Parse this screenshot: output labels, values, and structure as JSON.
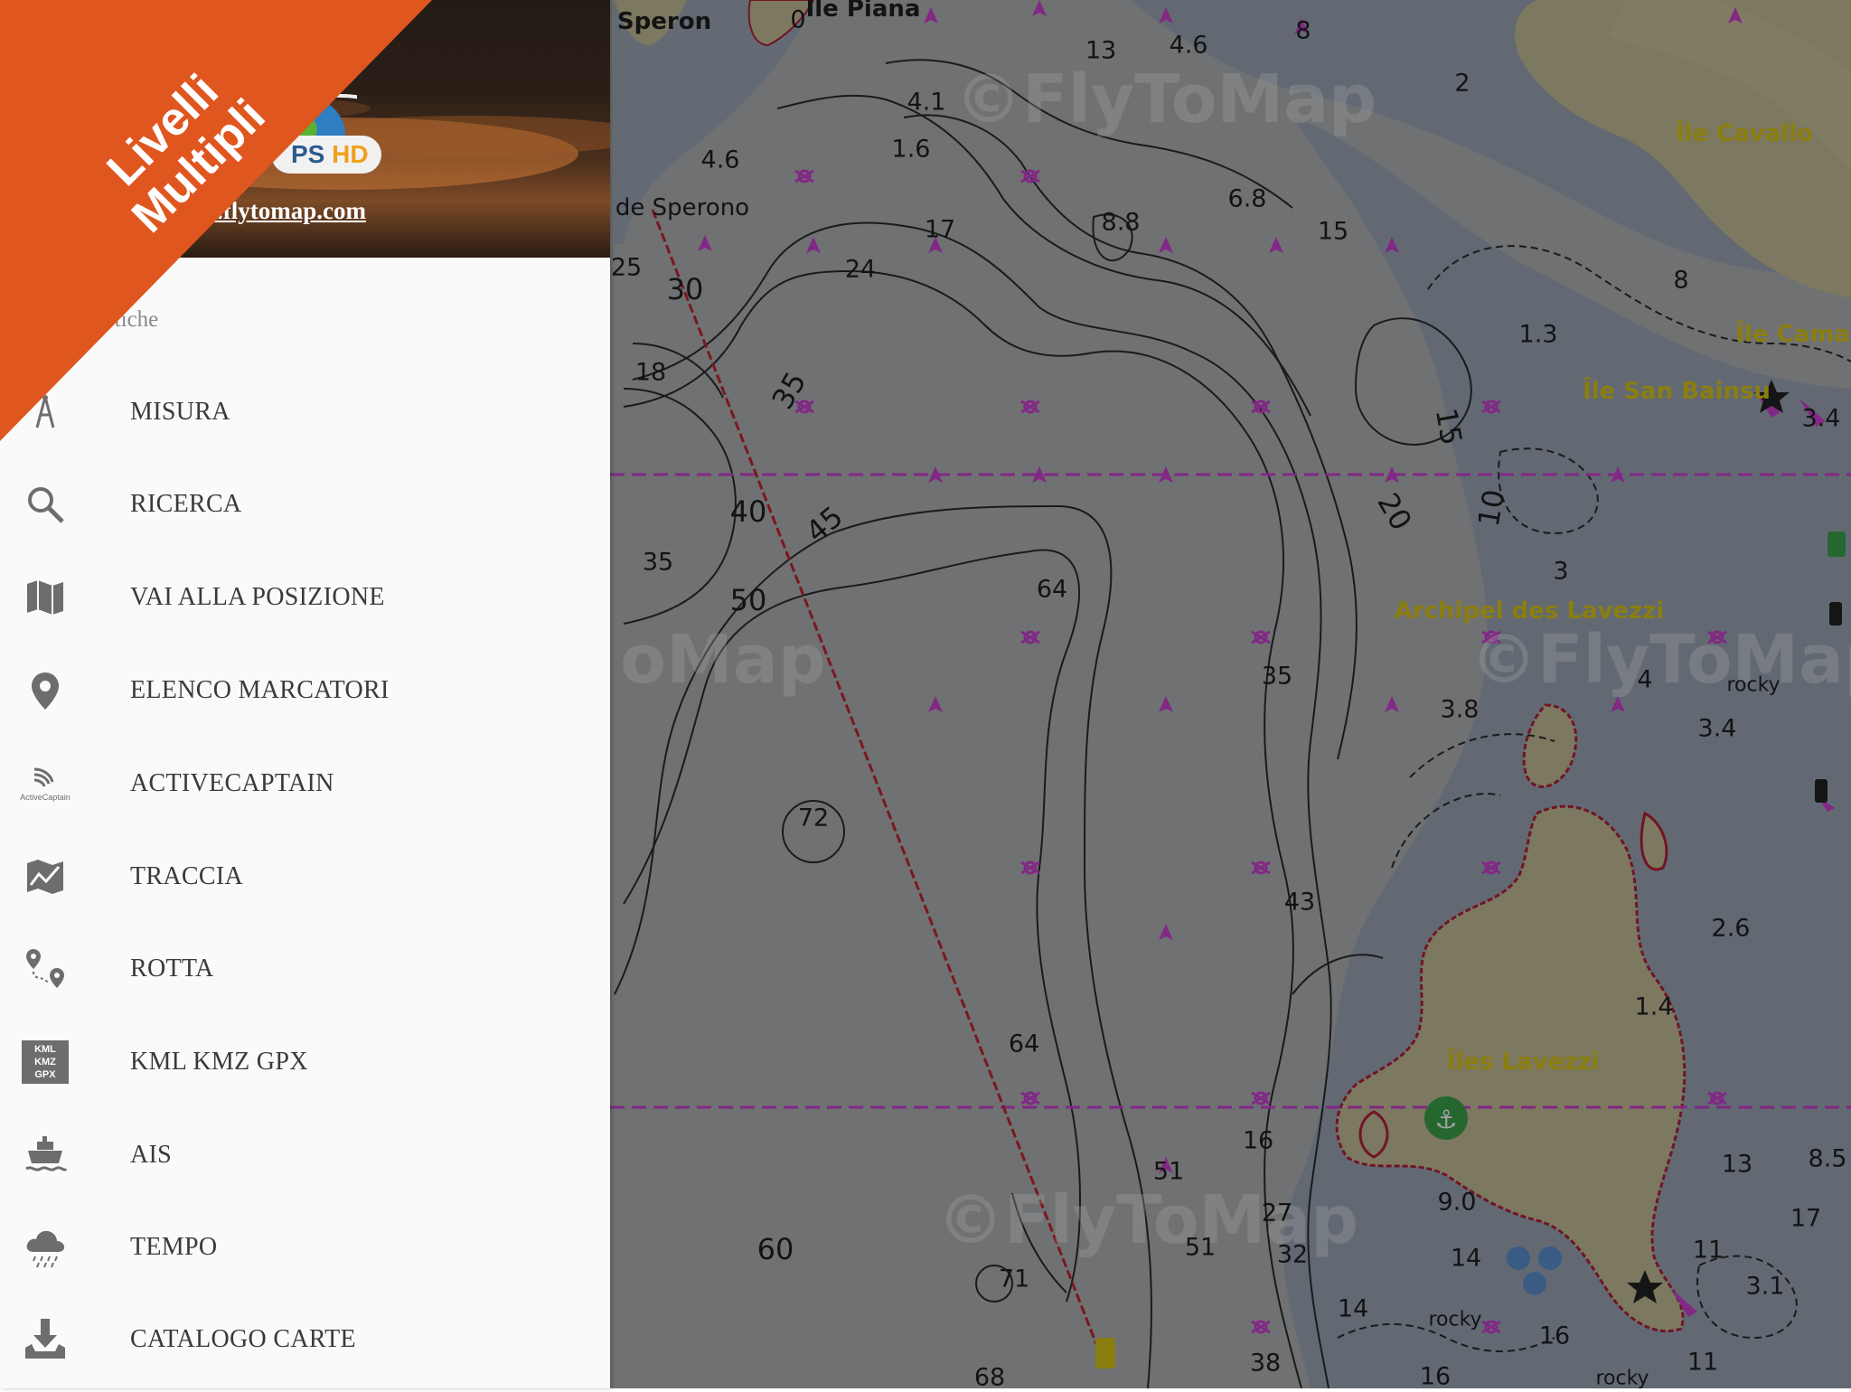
{
  "ribbon": {
    "line1": "Livelli",
    "line2": "Multipli",
    "color": "#e0561f"
  },
  "drawer": {
    "header": {
      "badge_partial": "PS",
      "badge_hd": "HD",
      "site_link": "ver.flytomap.com"
    },
    "section_label": "istiche",
    "items": [
      {
        "label": "MISURA",
        "icon": "compass-icon"
      },
      {
        "label": "RICERCA",
        "icon": "search-icon"
      },
      {
        "label": "VAI ALLA POSIZIONE",
        "icon": "map-icon"
      },
      {
        "label": "ELENCO MARCATORI",
        "icon": "location-pin-icon"
      },
      {
        "label": "ACTIVECAPTAIN",
        "icon": "activecaptain-icon",
        "icon_caption": "ActiveCaptain"
      },
      {
        "label": "TRACCIA",
        "icon": "track-map-icon"
      },
      {
        "label": "ROTTA",
        "icon": "route-icon"
      },
      {
        "label": "KML KMZ GPX",
        "icon": "kml-file-icon",
        "icon_lines": [
          "KML",
          "KMZ",
          "GPX"
        ]
      },
      {
        "label": "AIS",
        "icon": "ship-icon"
      },
      {
        "label": "TEMPO",
        "icon": "weather-cloud-icon"
      },
      {
        "label": "CATALOGO CARTE",
        "icon": "download-icon"
      }
    ]
  },
  "map": {
    "colors": {
      "sea": "#9aa5b5",
      "deep_sea": "#adb0b3",
      "land": "#c4bc96",
      "boundary": "#cc3fd1",
      "route": "#c1272d"
    },
    "watermarks": [
      "©FlyToMap",
      "©FlyToMap",
      "©FlyToMap",
      "oMap"
    ],
    "place_names": [
      "Speron",
      "Île Piana",
      "de Sperono",
      "Île Cavallo",
      "Île Camar",
      "Île San Bainsu",
      "Archipel des Lavezzi",
      "Îles Lavezzi",
      "rocky",
      "rocky",
      "rocky"
    ],
    "depths": [
      "0",
      "13",
      "4.6",
      "8",
      "2",
      "4.1",
      "1.6",
      "4.6",
      "6.8",
      "8.8",
      "15",
      "17",
      "24",
      "25",
      "30",
      "18",
      "35",
      "1.3",
      "8",
      "15",
      "3.4",
      "40",
      "45",
      "20",
      "10",
      "35",
      "50",
      "64",
      "3",
      "35",
      "4",
      "3.8",
      "3.4",
      "72",
      "43",
      "2.6",
      "1.4",
      "64",
      "16",
      "51",
      "13",
      "8.5",
      "27",
      "9.0",
      "17",
      "60",
      "71",
      "51",
      "32",
      "14",
      "11",
      "3.1",
      "14",
      "16",
      "11",
      "38",
      "16",
      "68"
    ]
  }
}
